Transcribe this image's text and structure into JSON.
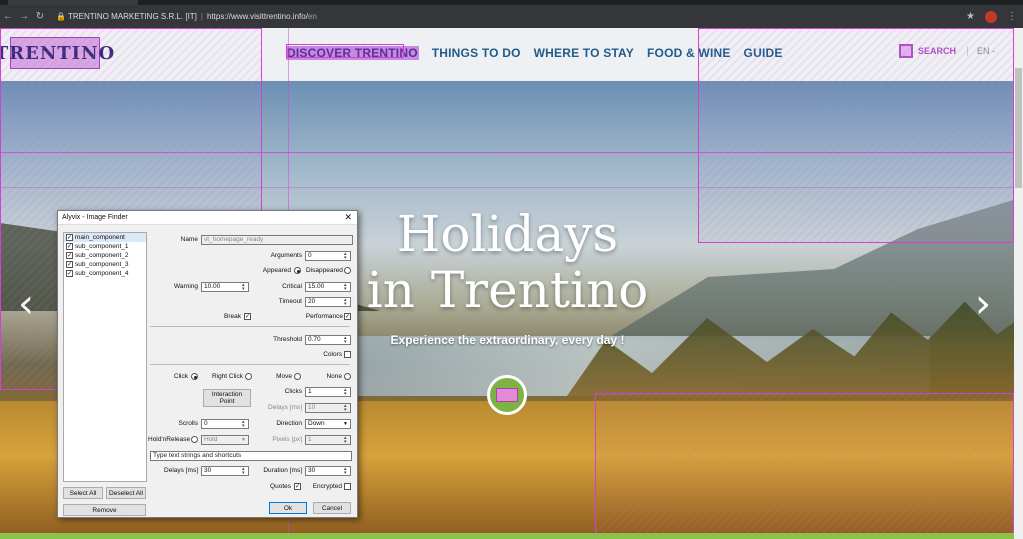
{
  "browser": {
    "site_name": "TRENTINO MARKETING S.R.L. [IT]",
    "separator": "|",
    "url_host": "https://www.visittrentino.info/",
    "url_path": "en"
  },
  "header": {
    "logo_text": "TRENTINO",
    "nav": [
      "DISCOVER TRENTINO",
      "THINGS TO DO",
      "WHERE TO STAY",
      "FOOD & WINE",
      "GUIDE"
    ],
    "search_label": "SEARCH",
    "language": "EN -"
  },
  "hero": {
    "title_line1": "Holidays",
    "title_line2": "in Trentino",
    "tagline": "Experience the extraordinary, every day !"
  },
  "dialog": {
    "title": "Alyvix - Image Finder",
    "close": "✕",
    "components": [
      "main_component",
      "sub_component_1",
      "sub_component_2",
      "sub_component_3",
      "sub_component_4"
    ],
    "select_all": "Select All",
    "deselect_all": "Deselect All",
    "remove": "Remove",
    "name_label": "Name",
    "name_value": "vt_homepage_ready",
    "arguments_label": "Arguments",
    "arguments_value": "0",
    "appeared_label": "Appeared",
    "disappeared_label": "Disappeared",
    "warning_label": "Warning",
    "warning_value": "10.00",
    "critical_label": "Critical",
    "critical_value": "15.00",
    "timeout_label": "Timeout",
    "timeout_value": "20",
    "break_label": "Break",
    "performance_label": "Performance",
    "threshold_label": "Threshold",
    "threshold_value": "0.70",
    "colors_label": "Colors",
    "click_label": "Click",
    "right_click_label": "Right Click",
    "move_label": "Move",
    "none_label": "None",
    "interaction_point": "Interaction Point",
    "clicks_label": "Clicks",
    "clicks_value": "1",
    "delays_ms_label": "Delays [ms]",
    "delays_ms_value": "10",
    "scrolls_label": "Scrolls",
    "scrolls_value": "0",
    "direction_label": "Direction",
    "direction_value": "Down",
    "holdnrelease_label": "Hold'nRelease",
    "hold_value": "Hold",
    "pixels_label": "Pixels [px]",
    "pixels_value": "1",
    "type_text_placeholder": "Type text strings and shortcuts",
    "delays_label": "Delays [ms]",
    "delays_value": "30",
    "duration_label": "Duration [ms]",
    "duration_value": "30",
    "quotes_label": "Quotes",
    "encrypted_label": "Encrypted",
    "ok": "Ok",
    "cancel": "Cancel"
  }
}
